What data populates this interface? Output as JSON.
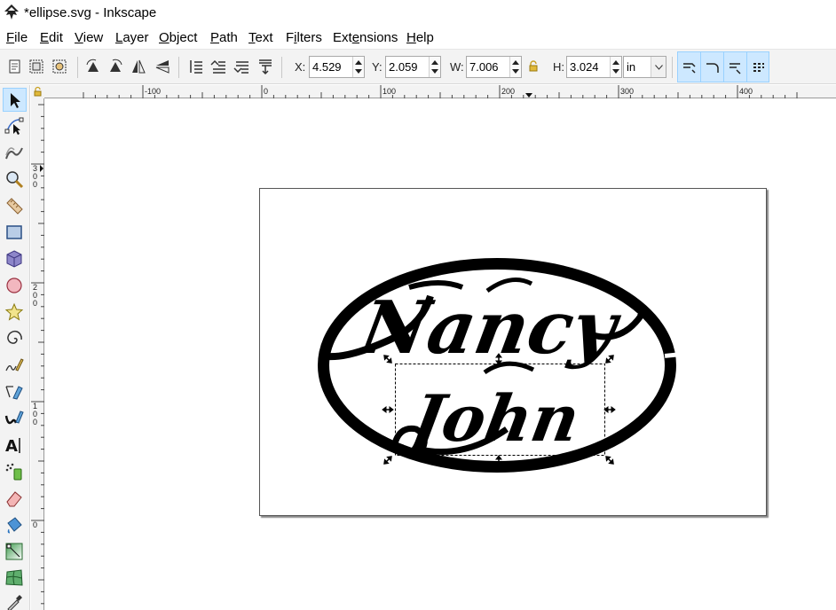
{
  "window": {
    "title": "*ellipse.svg - Inkscape",
    "app_icon": "inkscape-icon"
  },
  "menu": [
    {
      "label": "File",
      "mnemonic_index": 0
    },
    {
      "label": "Edit",
      "mnemonic_index": 0
    },
    {
      "label": "View",
      "mnemonic_index": 0
    },
    {
      "label": "Layer",
      "mnemonic_index": 0
    },
    {
      "label": "Object",
      "mnemonic_index": 0
    },
    {
      "label": "Path",
      "mnemonic_index": 0
    },
    {
      "label": "Text",
      "mnemonic_index": 0
    },
    {
      "label": "Filters",
      "mnemonic_index": 1
    },
    {
      "label": "Extensions",
      "mnemonic_index": 3
    },
    {
      "label": "Help",
      "mnemonic_index": 0
    }
  ],
  "tool_controls": {
    "icons": [
      "select-all-icon",
      "select-all-layers-icon",
      "deselect-icon",
      "rotate-ccw-icon",
      "rotate-cw-icon",
      "flip-horizontal-icon",
      "flip-vertical-icon",
      "raise-to-top-icon",
      "raise-icon",
      "lower-icon",
      "lower-to-bottom-icon"
    ],
    "x": {
      "label": "X:",
      "value": "4.529"
    },
    "y": {
      "label": "Y:",
      "value": "2.059"
    },
    "w": {
      "label": "W:",
      "value": "7.006"
    },
    "h": {
      "label": "H:",
      "value": "3.024"
    },
    "lock_icon": "lock-icon",
    "unit": "in",
    "transform_icons": [
      "scale-stroke-icon",
      "scale-corners-icon",
      "transform-gradients-icon",
      "transform-patterns-icon"
    ]
  },
  "toolbox": {
    "tools": [
      "selector-tool-icon",
      "node-tool-icon",
      "tweak-tool-icon",
      "zoom-tool-icon",
      "measure-tool-icon",
      "rectangle-tool-icon",
      "3d-box-tool-icon",
      "ellipse-tool-icon",
      "star-tool-icon",
      "spiral-tool-icon",
      "pencil-tool-icon",
      "pen-tool-icon",
      "calligraphy-tool-icon",
      "text-tool-icon",
      "spray-tool-icon",
      "eraser-tool-icon",
      "paint-bucket-tool-icon",
      "gradient-tool-icon",
      "mesh-tool-icon",
      "dropper-tool-icon"
    ],
    "active": "selector-tool-icon"
  },
  "rulers": {
    "horizontal_labels": [
      "-100",
      "0",
      "100",
      "200",
      "300",
      "400"
    ],
    "vertical_labels": [
      "300",
      "200",
      "100",
      "0"
    ]
  },
  "drawing": {
    "text_line_1": "Nancy",
    "text_line_2": "John",
    "colors": {
      "ink": "#000000",
      "page_border": "#555555",
      "page_shadow": "#8a8a8a"
    }
  }
}
